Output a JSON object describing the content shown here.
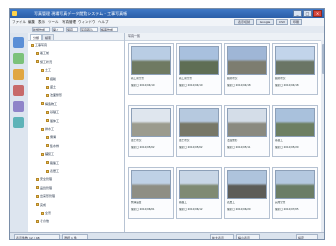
{
  "window": {
    "title": "写真管理 現場写真データ閲覧システム - 工事写真帳",
    "buttons": [
      "_",
      "□",
      "×"
    ]
  },
  "menu": [
    "ファイル",
    "編集",
    "表示",
    "ツール",
    "写真管理",
    "ウィンドウ",
    "ヘルプ"
  ],
  "menu_right": [
    "表示切替",
    "Google",
    "CSV",
    "印刷"
  ],
  "toolbar": [
    "新規作成",
    "開く",
    "保存",
    "写真取込",
    "帳票作成"
  ],
  "tree": {
    "tabs": [
      "分類",
      "検索"
    ],
    "rows": [
      "工事写真",
      "着工前",
      "施工状況",
      "土工",
      "掘削",
      "盛土",
      "法面整形",
      "構造物工",
      "基礎工",
      "躯体工",
      "排水工",
      "側溝",
      "集水桝",
      "舗装工",
      "路盤工",
      "表層工",
      "安全管理",
      "品質管理",
      "出来形管理",
      "完成",
      "全景",
      "その他"
    ]
  },
  "thumbs": {
    "header": "写真一覧",
    "items": [
      {
        "c1": "着工前全景",
        "c2": "撮影日 2012/04/10"
      },
      {
        "c1": "着工前全景",
        "c2": "撮影日 2012/04/10"
      },
      {
        "c1": "掘削状況",
        "c2": "撮影日 2012/04/18"
      },
      {
        "c1": "掘削状況",
        "c2": "撮影日 2012/04/18"
      },
      {
        "c1": "盛土状況",
        "c2": "撮影日 2012/05/02"
      },
      {
        "c1": "盛土状況",
        "c2": "撮影日 2012/05/02"
      },
      {
        "c1": "法面整形",
        "c2": "撮影日 2012/05/11"
      },
      {
        "c1": "基礎工",
        "c2": "撮影日 2012/05/20"
      },
      {
        "c1": "側溝設置",
        "c2": "撮影日 2012/06/01"
      },
      {
        "c1": "路盤工",
        "c2": "撮影日 2012/06/12"
      },
      {
        "c1": "表層工",
        "c2": "撮影日 2012/06/20"
      },
      {
        "c1": "完成全景",
        "c2": "撮影日 2012/07/05"
      }
    ]
  },
  "status": [
    "表示件数 12 / 48",
    "選択 1 件",
    "拡大表示",
    "縮小表示",
    "設定"
  ],
  "colors": {
    "accent": "#2a5ea8",
    "sky": "#9bb8d8",
    "ground": "#8a8a7a"
  }
}
